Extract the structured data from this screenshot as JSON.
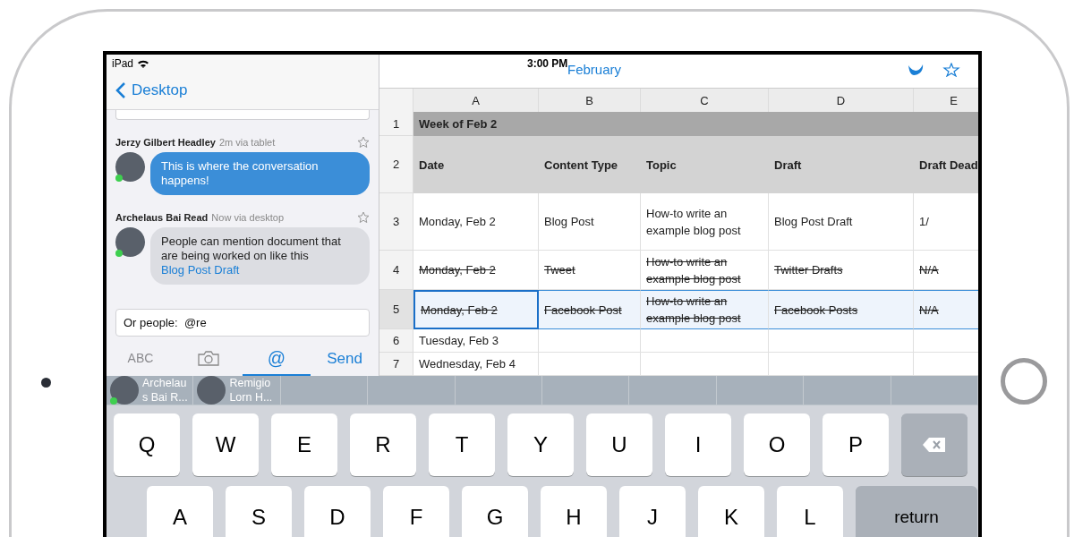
{
  "status_bar": {
    "device": "iPad",
    "time": "3:00 PM"
  },
  "nav": {
    "back_label": "Desktop"
  },
  "messages": [
    {
      "author": "Jerzy Gilbert Headley",
      "meta": "2m via tablet",
      "text": "This is where the conversation happens!",
      "own": true,
      "online": true,
      "starred": false
    },
    {
      "author": "Archelaus Bai Read",
      "meta": "Now via desktop",
      "text": "People can mention document that are being worked on like this",
      "link": "Blog Post Draft",
      "own": false,
      "online": true,
      "starred": false
    }
  ],
  "composer": {
    "value": "Or people:  @re"
  },
  "input_modes": [
    {
      "kind": "text",
      "label": "ABC",
      "selected": false
    },
    {
      "kind": "camera",
      "selected": false
    },
    {
      "kind": "text",
      "label": "@",
      "selected": true
    }
  ],
  "send_button": "Send",
  "mention_suggestions": [
    {
      "name": "Archelaus Bai R...",
      "online": true
    },
    {
      "name": "Remigio Lorn H...",
      "online": false
    }
  ],
  "spreadsheet": {
    "toolbar_link": "February",
    "columns": [
      "A",
      "B",
      "C",
      "D",
      "E"
    ],
    "rows": [
      {
        "number": "1",
        "kind": "section",
        "cells": [
          "Week of Feb 2"
        ]
      },
      {
        "number": "2",
        "kind": "header",
        "cells": [
          "Date",
          "Content Type",
          "Topic",
          "Draft",
          "Draft Dead"
        ]
      },
      {
        "number": "3",
        "kind": "data",
        "struck": false,
        "selected": false,
        "cells": [
          {
            "text": "Monday, Feb 2",
            "selected": false
          },
          {
            "text": "Blog Post",
            "selected": false
          },
          {
            "text": "How-to write an example blog post",
            "selected": false
          },
          {
            "text": "Blog Post Draft",
            "selected": false
          },
          {
            "text": "1/",
            "selected": false
          }
        ]
      },
      {
        "number": "4",
        "kind": "data",
        "struck": true,
        "selected": false,
        "cells": [
          {
            "text": "Monday, Feb 2",
            "selected": false
          },
          {
            "text": "Tweet",
            "selected": false
          },
          {
            "text": "How-to write an example blog post",
            "selected": false
          },
          {
            "text": "Twitter Drafts",
            "selected": false
          },
          {
            "text": "N/A",
            "selected": false
          }
        ]
      },
      {
        "number": "5",
        "kind": "data",
        "struck": true,
        "selected": true,
        "cells": [
          {
            "text": "Monday, Feb 2",
            "selected": true
          },
          {
            "text": "Facebook Post",
            "selected": false
          },
          {
            "text": "How-to write an example blog post",
            "selected": false
          },
          {
            "text": "Facebook Posts",
            "selected": false
          },
          {
            "text": "N/A",
            "selected": false
          }
        ]
      },
      {
        "number": "6",
        "kind": "data",
        "struck": false,
        "selected": false,
        "cells": [
          {
            "text": "Tuesday, Feb 3",
            "selected": false
          },
          {
            "selected": false
          },
          {
            "selected": false
          },
          {
            "selected": false
          },
          {
            "selected": false
          }
        ]
      },
      {
        "number": "7",
        "kind": "data",
        "struck": false,
        "selected": false,
        "cells": [
          {
            "text": "Wednesday, Feb 4",
            "selected": false
          },
          {
            "selected": false
          },
          {
            "selected": false
          },
          {
            "selected": false
          },
          {
            "selected": false
          }
        ]
      }
    ]
  },
  "keyboard": {
    "rows": [
      [
        {
          "kind": "letter",
          "label": "Q"
        },
        {
          "kind": "letter",
          "label": "W"
        },
        {
          "kind": "letter",
          "label": "E"
        },
        {
          "kind": "letter",
          "label": "R"
        },
        {
          "kind": "letter",
          "label": "T"
        },
        {
          "kind": "letter",
          "label": "Y"
        },
        {
          "kind": "letter",
          "label": "U"
        },
        {
          "kind": "letter",
          "label": "I"
        },
        {
          "kind": "letter",
          "label": "O"
        },
        {
          "kind": "letter",
          "label": "P"
        },
        {
          "kind": "delete"
        }
      ],
      [
        {
          "kind": "letter",
          "label": "A"
        },
        {
          "kind": "letter",
          "label": "S"
        },
        {
          "kind": "letter",
          "label": "D"
        },
        {
          "kind": "letter",
          "label": "F"
        },
        {
          "kind": "letter",
          "label": "G"
        },
        {
          "kind": "letter",
          "label": "H"
        },
        {
          "kind": "letter",
          "label": "J"
        },
        {
          "kind": "letter",
          "label": "K"
        },
        {
          "kind": "letter",
          "label": "L"
        },
        {
          "kind": "return",
          "label": "return"
        }
      ]
    ]
  }
}
